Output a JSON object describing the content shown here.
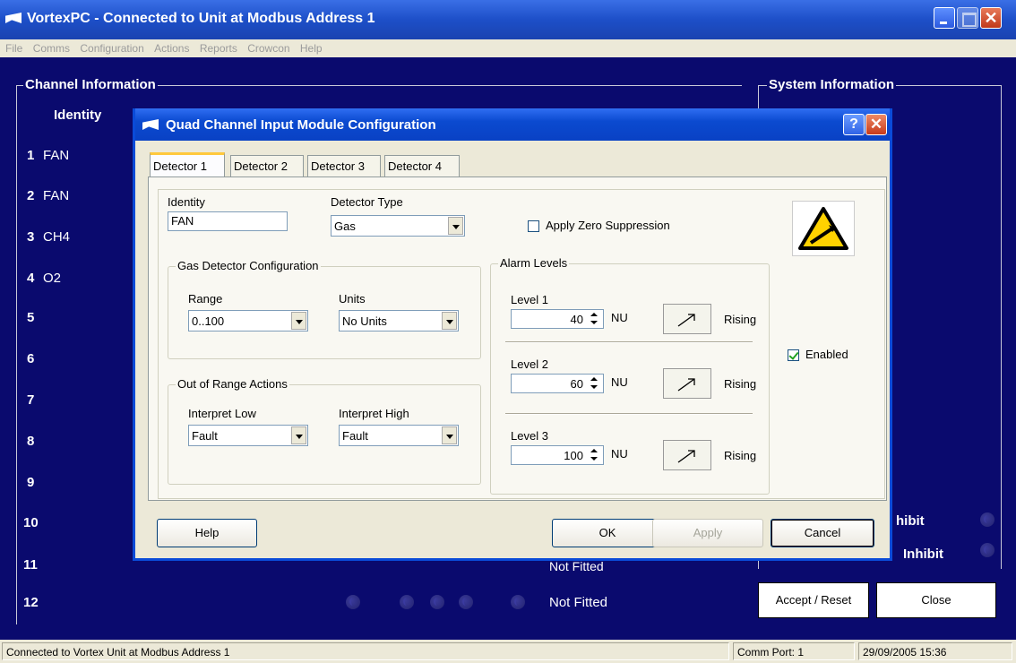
{
  "window": {
    "title": "VortexPC - Connected to Unit at Modbus Address 1"
  },
  "menu": [
    "File",
    "Comms",
    "Configuration",
    "Actions",
    "Reports",
    "Crowcon",
    "Help"
  ],
  "channel_info": {
    "label": "Channel Information",
    "identity_header": "Identity",
    "rows": [
      {
        "num": "1",
        "name": "FAN"
      },
      {
        "num": "2",
        "name": "FAN"
      },
      {
        "num": "3",
        "name": "CH4"
      },
      {
        "num": "4",
        "name": "O2"
      },
      {
        "num": "5",
        "name": ""
      },
      {
        "num": "6",
        "name": ""
      },
      {
        "num": "7",
        "name": ""
      },
      {
        "num": "8",
        "name": ""
      },
      {
        "num": "9",
        "name": ""
      },
      {
        "num": "10",
        "name": ""
      },
      {
        "num": "11",
        "name": ""
      },
      {
        "num": "12",
        "name": ""
      }
    ],
    "row11_status": "Not Fitted",
    "row12_status": "Not Fitted"
  },
  "system_info": {
    "label": "System Information",
    "inhibit1": "hibit",
    "inhibit2": "Inhibit",
    "accept_reset": "Accept / Reset",
    "close": "Close"
  },
  "status_bar": {
    "message": "Connected to Vortex Unit at Modbus Address 1",
    "comm_port": "Comm Port:  1",
    "datetime": "29/09/2005  15:36"
  },
  "dialog": {
    "title": "Quad Channel Input Module Configuration",
    "help_glyph": "?",
    "close_glyph": "✕",
    "tabs": [
      "Detector 1",
      "Detector 2",
      "Detector 3",
      "Detector 4"
    ],
    "identity_label": "Identity",
    "identity_value": "FAN",
    "detector_type_label": "Detector Type",
    "detector_type_value": "Gas",
    "apply_zero_suppression": "Apply Zero Suppression",
    "gas_config_label": "Gas Detector Configuration",
    "range_label": "Range",
    "range_value": "0..100",
    "units_label": "Units",
    "units_value": "No Units",
    "out_of_range_label": "Out of Range Actions",
    "interpret_low_label": "Interpret Low",
    "interpret_low_value": "Fault",
    "interpret_high_label": "Interpret High",
    "interpret_high_value": "Fault",
    "alarm_levels_label": "Alarm Levels",
    "levels": [
      {
        "label": "Level 1",
        "value": "40",
        "unit": "NU",
        "direction": "Rising"
      },
      {
        "label": "Level 2",
        "value": "60",
        "unit": "NU",
        "direction": "Rising"
      },
      {
        "label": "Level 3",
        "value": "100",
        "unit": "NU",
        "direction": "Rising"
      }
    ],
    "enabled_label": "Enabled",
    "enabled_checked": true,
    "buttons": {
      "help": "Help",
      "ok": "OK",
      "apply": "Apply",
      "cancel": "Cancel"
    }
  }
}
